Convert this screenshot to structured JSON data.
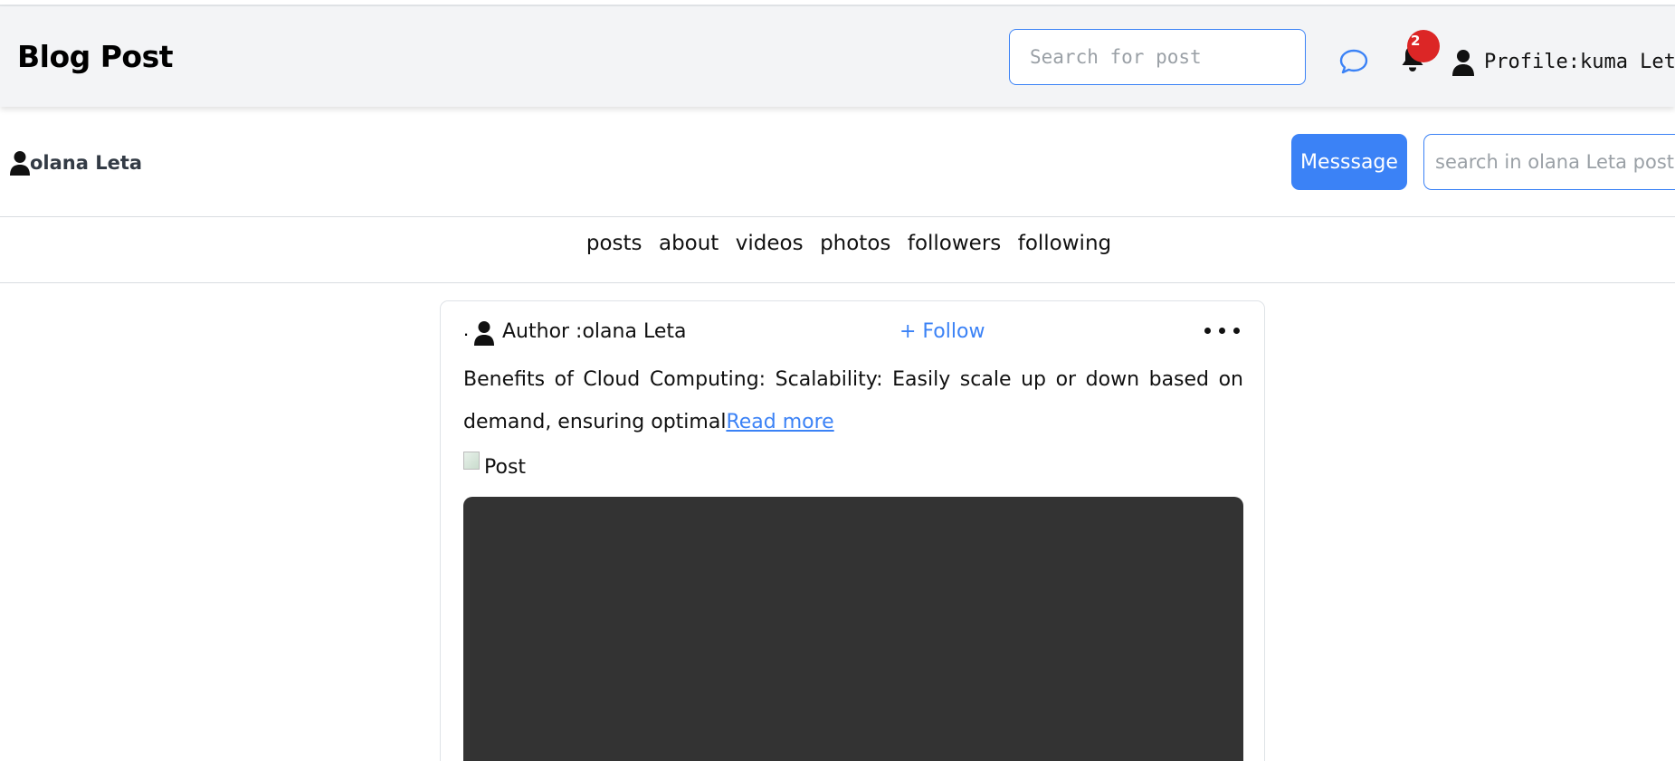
{
  "header": {
    "brand": "Blog Post",
    "search_placeholder": "Search for post",
    "notification_count": "2",
    "profile_label": "Profile:kuma Leta"
  },
  "profile_bar": {
    "user_name": "olana Leta",
    "message_label": "Messsage",
    "search_placeholder": "search in olana Leta post,"
  },
  "tabs": [
    "posts",
    "about",
    "videos",
    "photos",
    "followers",
    "following"
  ],
  "post": {
    "lead": ".",
    "author": "Author :olana Leta",
    "follow_label": "+ Follow",
    "text": "Benefits of Cloud Computing: Scalability: Easily scale up or down based on demand, ensuring optimal",
    "read_more": "Read more",
    "image_alt": "Post"
  },
  "colors": {
    "accent": "#3b82f6",
    "badge": "#dc2626",
    "header_bg": "#f3f4f6",
    "video_bg": "#333333"
  },
  "icons": {
    "chat": "chat-bubble-icon",
    "notifications": "bell-icon",
    "profile": "person-icon",
    "more": "more-dots-icon"
  }
}
